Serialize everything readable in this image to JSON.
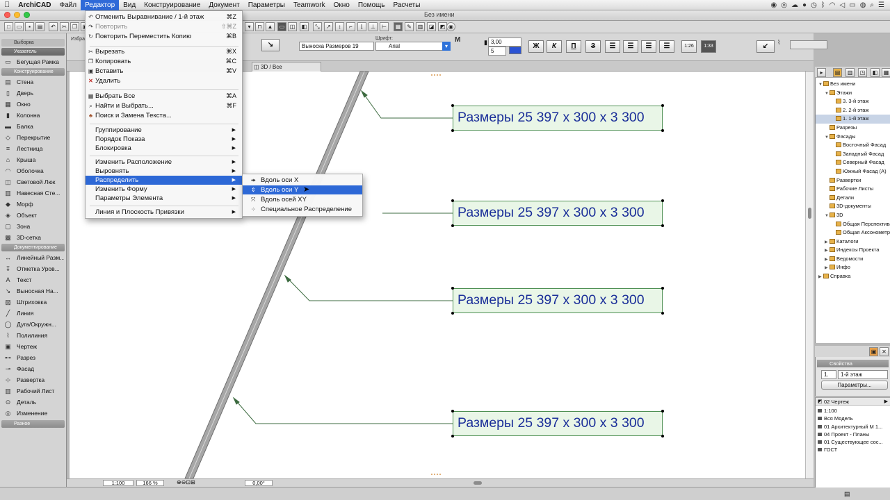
{
  "menubar": {
    "apple": "",
    "items": [
      "ArchiCAD",
      "Файл",
      "Редактор",
      "Вид",
      "Конструирование",
      "Документ",
      "Параметры",
      "Teamwork",
      "Окно",
      "Помощь",
      "Расчеты"
    ],
    "active_index": 2
  },
  "window": {
    "title": "Без имени"
  },
  "toolbar2": {
    "favorites_label": "Избранное",
    "label_style": "Выноска Размеров 19",
    "font_label": "Шрифт:",
    "font_name": "Arial",
    "size_value": "3,00",
    "spacing_value": "5",
    "bold": "Ж",
    "italic": "К",
    "underline": "П",
    "strike": "З",
    "scale1": "1:26",
    "scale2": "1:33"
  },
  "toolbox": {
    "group_selection": "Выборка",
    "pointer": "Указатель",
    "marquee": "Бегущая Рамка",
    "group_design": "Конструирование",
    "design_tools": [
      "Стена",
      "Дверь",
      "Окно",
      "Колонна",
      "Балка",
      "Перекрытие",
      "Лестница",
      "Крыша",
      "Оболочка",
      "Световой Люк",
      "Навесная Сте...",
      "Морф",
      "Объект",
      "Зона",
      "3D-сетка"
    ],
    "group_docs": "Документирование",
    "doc_tools": [
      "Линейный Разм...",
      "Отметка Уров...",
      "Текст",
      "Выносная На...",
      "Штриховка",
      "Линия",
      "Дуга/Окружн...",
      "Полилиния",
      "Чертеж",
      "Разрез",
      "Фасад",
      "Развертка",
      "Рабочий Лист",
      "Деталь",
      "Изменение"
    ],
    "group_other": "Разное"
  },
  "tabbar": {
    "active_tab": "3D / Все"
  },
  "edit_menu": {
    "undo": "Отменить Выравнивание / 1-й этаж",
    "undo_sc": "⌘Z",
    "redo": "Повторить",
    "redo_sc": "⇧⌘Z",
    "repeat": "Повторить Переместить Копию",
    "repeat_sc": "⌘B",
    "cut": "Вырезать",
    "cut_sc": "⌘X",
    "copy": "Копировать",
    "copy_sc": "⌘C",
    "paste": "Вставить",
    "paste_sc": "⌘V",
    "delete": "Удалить",
    "select_all": "Выбрать Все",
    "select_all_sc": "⌘A",
    "find_select": "Найти и Выбрать...",
    "find_select_sc": "⌘F",
    "find_replace": "Поиск и Замена Текста...",
    "grouping": "Группирование",
    "display_order": "Порядок Показа",
    "locking": "Блокировка",
    "reshape_pos": "Изменить Расположение",
    "align": "Выровнять",
    "distribute": "Распределить",
    "reshape": "Изменить Форму",
    "element_settings": "Параметры Элемента",
    "snap": "Линия и Плоскость Привязки"
  },
  "distribute_submenu": {
    "along_x": "Вдоль оси X",
    "along_y": "Вдоль оси Y",
    "along_xy": "Вдоль осей XY",
    "special": "Специальное Распределение"
  },
  "canvas": {
    "callouts": [
      "Размеры  25 397 x 300 x 3 300",
      "Размеры  25 397 x 300 x 3 300",
      "Размеры  25 397 x 300 x 3 300",
      "Размеры  25 397 x 300 x 3 300"
    ],
    "callout_fill": "#e9f6e7",
    "callout_border": "#4d8f52",
    "callout_text_color": "#1b2f99"
  },
  "bottom_bar": {
    "scale": "1:100",
    "zoom": "166 %",
    "angle": "0,00°"
  },
  "navigator": {
    "items": [
      {
        "label": "Без имени",
        "depth": 0,
        "tri": "▼"
      },
      {
        "label": "Этажи",
        "depth": 1,
        "tri": "▼"
      },
      {
        "label": "3. 3-й этаж",
        "depth": 2,
        "tri": ""
      },
      {
        "label": "2. 2-й этаж",
        "depth": 2,
        "tri": ""
      },
      {
        "label": "1. 1-й этаж",
        "depth": 2,
        "tri": "",
        "selected": true
      },
      {
        "label": "Разрезы",
        "depth": 1,
        "tri": ""
      },
      {
        "label": "Фасады",
        "depth": 1,
        "tri": "▼"
      },
      {
        "label": "Восточный Фасад",
        "depth": 2,
        "tri": ""
      },
      {
        "label": "Западный Фасад",
        "depth": 2,
        "tri": ""
      },
      {
        "label": "Северный Фасад",
        "depth": 2,
        "tri": ""
      },
      {
        "label": "Южный Фасад (А)",
        "depth": 2,
        "tri": ""
      },
      {
        "label": "Развертки",
        "depth": 1,
        "tri": ""
      },
      {
        "label": "Рабочие Листы",
        "depth": 1,
        "tri": ""
      },
      {
        "label": "Детали",
        "depth": 1,
        "tri": ""
      },
      {
        "label": "3D-документы",
        "depth": 1,
        "tri": ""
      },
      {
        "label": "3D",
        "depth": 1,
        "tri": "▼"
      },
      {
        "label": "Общая Перспектива",
        "depth": 2,
        "tri": ""
      },
      {
        "label": "Общая Аксонометрия",
        "depth": 2,
        "tri": ""
      },
      {
        "label": "Каталоги",
        "depth": 1,
        "tri": "▶"
      },
      {
        "label": "Индексы Проекта",
        "depth": 1,
        "tri": "▶"
      },
      {
        "label": "Ведомости",
        "depth": 1,
        "tri": "▶"
      },
      {
        "label": "Инфо",
        "depth": 1,
        "tri": "▶"
      },
      {
        "label": "Справка",
        "depth": 0,
        "tri": "▶"
      }
    ]
  },
  "properties": {
    "header": "Свойства",
    "story_num": "1.",
    "story_name": "1-й этаж",
    "settings_button": "Параметры..."
  },
  "layers": {
    "header": "02 Чертеж",
    "items": [
      "1:100",
      "Вся Модель",
      "01 Архитектурный М 1...",
      "04 Проект - Планы",
      "01 Существующее сос...",
      "ГОСТ"
    ]
  }
}
